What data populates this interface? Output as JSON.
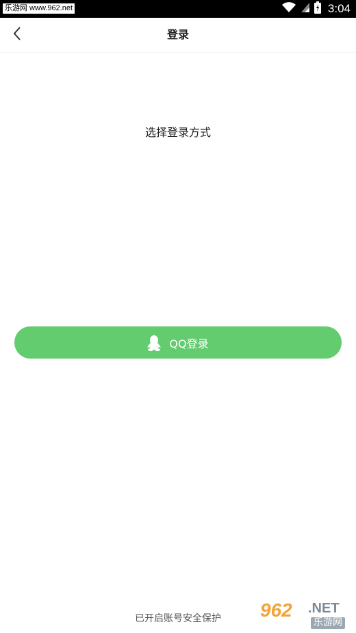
{
  "status_bar": {
    "watermark_tag": "乐游网 www.962.net",
    "time": "3:04",
    "icons": [
      "wifi-icon",
      "signal-icon",
      "battery-icon"
    ]
  },
  "header": {
    "title": "登录",
    "back_icon": "chevron-left-icon"
  },
  "main": {
    "prompt": "选择登录方式",
    "qq_button": {
      "label": "QQ登录",
      "icon": "qq-penguin-icon"
    }
  },
  "footer": {
    "note": "已开启账号安全保护"
  },
  "watermark": {
    "number": "962",
    "suffix": ".NET",
    "cn": "乐游网"
  },
  "colors": {
    "accent": "#63cc6f",
    "status_bar": "#000000",
    "text": "#222222"
  }
}
